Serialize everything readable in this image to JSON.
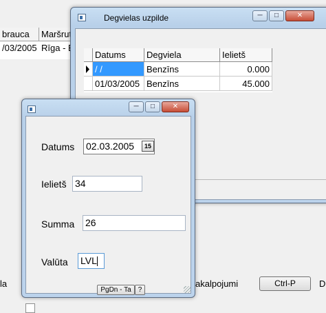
{
  "background_app": {
    "grid": {
      "headers": [
        "brauca",
        "Maršrut"
      ],
      "row": [
        "/03/2005",
        "Rīga - B"
      ]
    },
    "bottom_left_label": "la",
    "bottom_service_label": "akalpojumi",
    "bottom_button": "Ctrl-P",
    "bottom_right_label": "D"
  },
  "fuel_window": {
    "title": "Degvielas uzpilde",
    "columns": [
      "Datums",
      "Degviela",
      "Ielietš"
    ],
    "rows": [
      {
        "datums": " /  /",
        "degviela": "Benzīns",
        "ielietis": "0.000"
      },
      {
        "datums": "01/03/2005",
        "degviela": "Benzīns",
        "ielietis": "45.000"
      }
    ]
  },
  "entry_window": {
    "title": "",
    "fields": {
      "datums_label": "Datums",
      "datums_value": "02.03.2005",
      "calendar_icon": "15",
      "ielietis_label": "Ielietš",
      "ielietis_value": "34",
      "summa_label": "Summa",
      "summa_value": "26",
      "valuta_label": "Valūta",
      "valuta_value": "LVL"
    },
    "pgdn_button": "PgDn - Ta",
    "help_button": "?"
  }
}
